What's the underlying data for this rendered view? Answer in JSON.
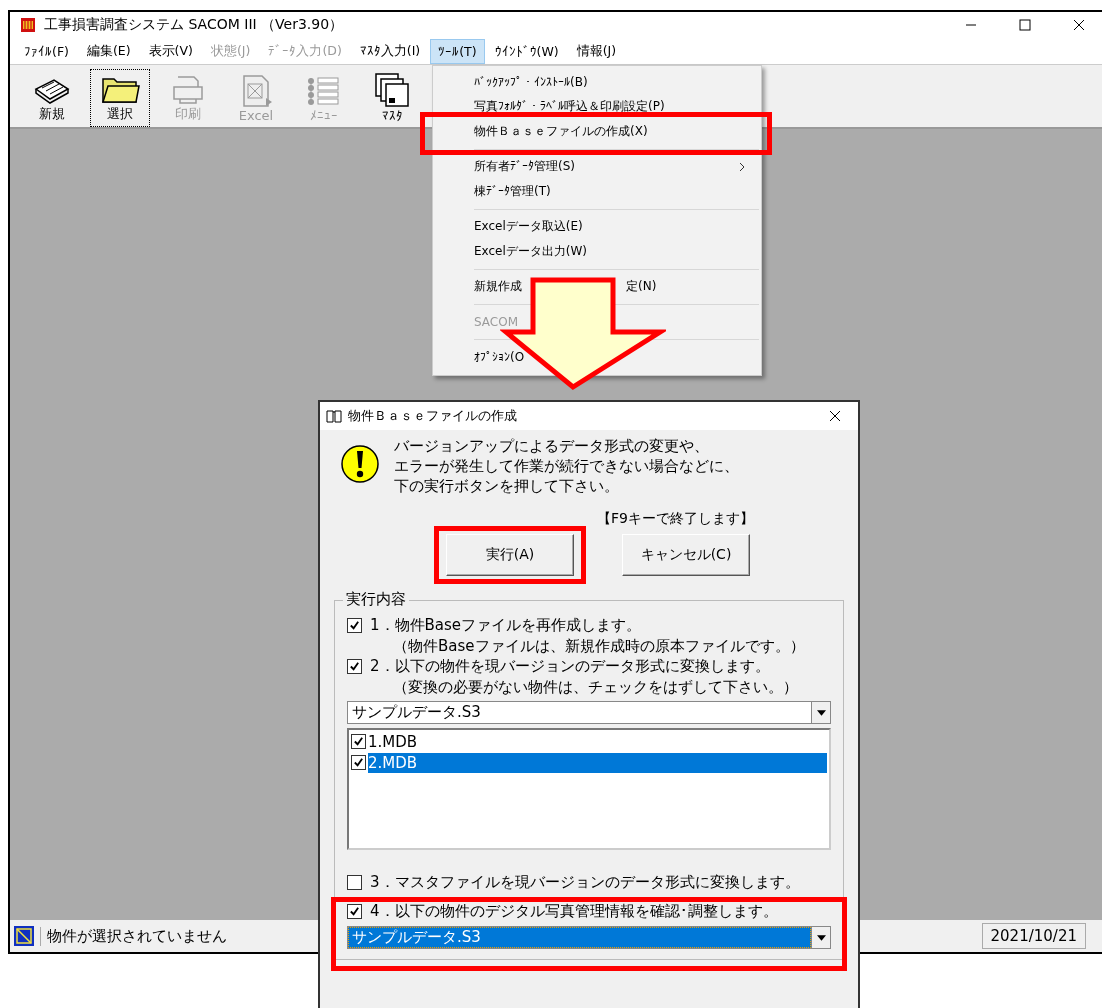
{
  "window": {
    "title": "工事損害調査システム SACOM III （Ver3.90）"
  },
  "menu_bar": [
    {
      "label": "ﾌｧｲﾙ(F)",
      "disabled": false,
      "selected": false
    },
    {
      "label": "編集(E)",
      "disabled": false,
      "selected": false
    },
    {
      "label": "表示(V)",
      "disabled": false,
      "selected": false
    },
    {
      "label": "状態(J)",
      "disabled": true,
      "selected": false
    },
    {
      "label": "ﾃﾞｰﾀ入力(D)",
      "disabled": true,
      "selected": false
    },
    {
      "label": "ﾏｽﾀ入力(I)",
      "disabled": false,
      "selected": false
    },
    {
      "label": "ﾂｰﾙ(T)",
      "disabled": false,
      "selected": true
    },
    {
      "label": "ｳｲﾝﾄﾞｳ(W)",
      "disabled": false,
      "selected": false
    },
    {
      "label": "情報(J)",
      "disabled": false,
      "selected": false
    }
  ],
  "toolbar": [
    {
      "kind": "book",
      "label": "新規",
      "disabled": false,
      "selected": false
    },
    {
      "kind": "folder",
      "label": "選択",
      "disabled": false,
      "selected": true
    },
    {
      "kind": "printer",
      "label": "印刷",
      "disabled": true,
      "selected": false
    },
    {
      "kind": "excel",
      "label": "Excel",
      "disabled": true,
      "selected": false
    },
    {
      "kind": "menu",
      "label": "ﾒﾆｭｰ",
      "disabled": true,
      "selected": false
    },
    {
      "kind": "floppy",
      "label": "ﾏｽﾀ",
      "disabled": false,
      "selected": false
    }
  ],
  "tools_menu": [
    [
      {
        "label": "ﾊﾞｯｸｱｯﾌﾟ・ｲﾝｽﾄｰﾙ(B)",
        "disabled": false,
        "highlighted": false,
        "submenu": false
      },
      {
        "label": "写真ﾌｫﾙﾀﾞ・ﾗﾍﾞﾙ呼込＆印刷設定(P)",
        "disabled": false,
        "highlighted": false,
        "submenu": false
      },
      {
        "label": "物件Ｂａｓｅファイルの作成(X)",
        "disabled": false,
        "highlighted": true,
        "submenu": false
      }
    ],
    [
      {
        "label": "所有者ﾃﾞｰﾀ管理(S)",
        "disabled": false,
        "highlighted": false,
        "submenu": true
      },
      {
        "label": "棟ﾃﾞｰﾀ管理(T)",
        "disabled": false,
        "highlighted": false,
        "submenu": false
      }
    ],
    [
      {
        "label": "Excelデータ取込(E)",
        "disabled": false,
        "highlighted": false,
        "submenu": false
      },
      {
        "label": "Excelデータ出力(W)",
        "disabled": false,
        "highlighted": false,
        "submenu": false
      }
    ],
    [
      {
        "label": "新規作成",
        "label_end": "定(N)",
        "disabled": false,
        "highlighted": false,
        "submenu": false
      }
    ],
    [
      {
        "label": "SACOM",
        "disabled": true,
        "highlighted": false,
        "submenu": false
      }
    ],
    [
      {
        "label": "ｵﾌﾟｼｮﾝ(O",
        "disabled": false,
        "highlighted": false,
        "submenu": false
      }
    ]
  ],
  "status_bar": {
    "message": "物件が選択されていません",
    "date": "2021/10/21"
  },
  "dialog": {
    "title": "物件Ｂａｓｅファイルの作成",
    "message": [
      "バージョンアップによるデータ形式の変更や、",
      "エラーが発生して作業が続行できない場合などに、",
      "下の実行ボタンを押して下さい。"
    ],
    "hint": "【F9キーで終了します】",
    "buttons": [
      {
        "label": "実行(A)",
        "highlighted": true
      },
      {
        "label": "キャンセル(C)",
        "highlighted": false
      }
    ],
    "group_title": "実行内容",
    "options": [
      {
        "label": "1．物件Baseファイルを再作成します。",
        "note": "（物件Baseファイルは、新規作成時の原本ファイルです。）",
        "checked": true
      },
      {
        "label": "2．以下の物件を現バージョンのデータ形式に変換します。",
        "note": "（変換の必要がない物件は、チェックをはずして下さい。）",
        "checked": true
      }
    ],
    "combo": {
      "value": "サンプルデータ.S3",
      "focused": false
    },
    "files": [
      {
        "label": "1.MDB",
        "checked": true,
        "selected": false
      },
      {
        "label": "2.MDB",
        "checked": true,
        "selected": true
      }
    ],
    "options_after": [
      {
        "label": "3．マスタファイルを現バージョンのデータ形式に変換します。",
        "checked": false,
        "highlighted": false
      },
      {
        "label": "4．以下の物件のデジタル写真管理情報を確認･調整します。",
        "checked": true,
        "highlighted": true
      }
    ],
    "combo2": {
      "value": "サンプルデータ.S3",
      "focused": true
    }
  }
}
